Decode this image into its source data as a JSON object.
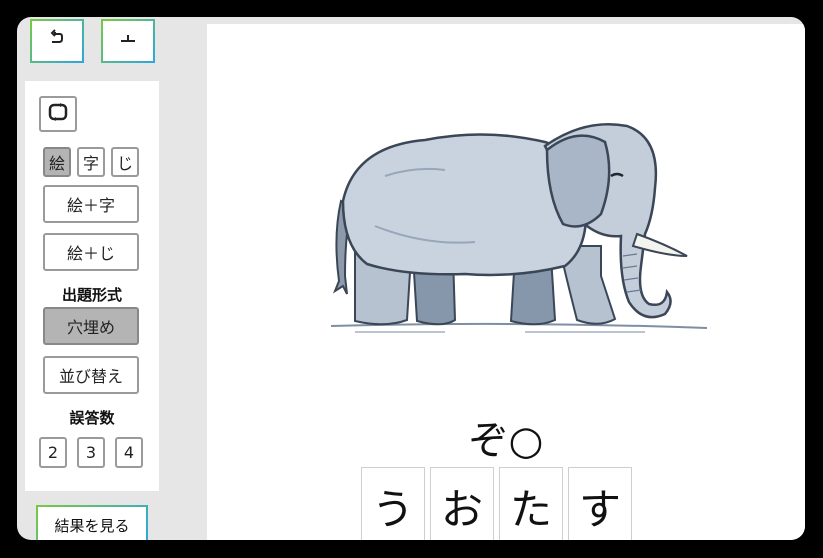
{
  "nav": {
    "undo_icon": "undo-arrow-icon",
    "redo_icon": "redo-arrow-icon"
  },
  "sidebar": {
    "refresh_icon": "refresh-icon",
    "display_modes": [
      {
        "label": "絵",
        "selected": true
      },
      {
        "label": "字",
        "selected": false
      },
      {
        "label": "じ",
        "selected": false
      }
    ],
    "combo_1": "絵＋字",
    "combo_2": "絵＋じ",
    "format_heading": "出題形式",
    "format_fill": "穴埋め",
    "format_sort": "並び替え",
    "wrong_count_heading": "誤答数",
    "wrong_counts": [
      "2",
      "3",
      "4"
    ],
    "results_button": "結果を見る"
  },
  "quiz": {
    "image_subject": "elephant-illustration",
    "question": "ぞ○",
    "choices": [
      "う",
      "お",
      "た",
      "す"
    ]
  }
}
